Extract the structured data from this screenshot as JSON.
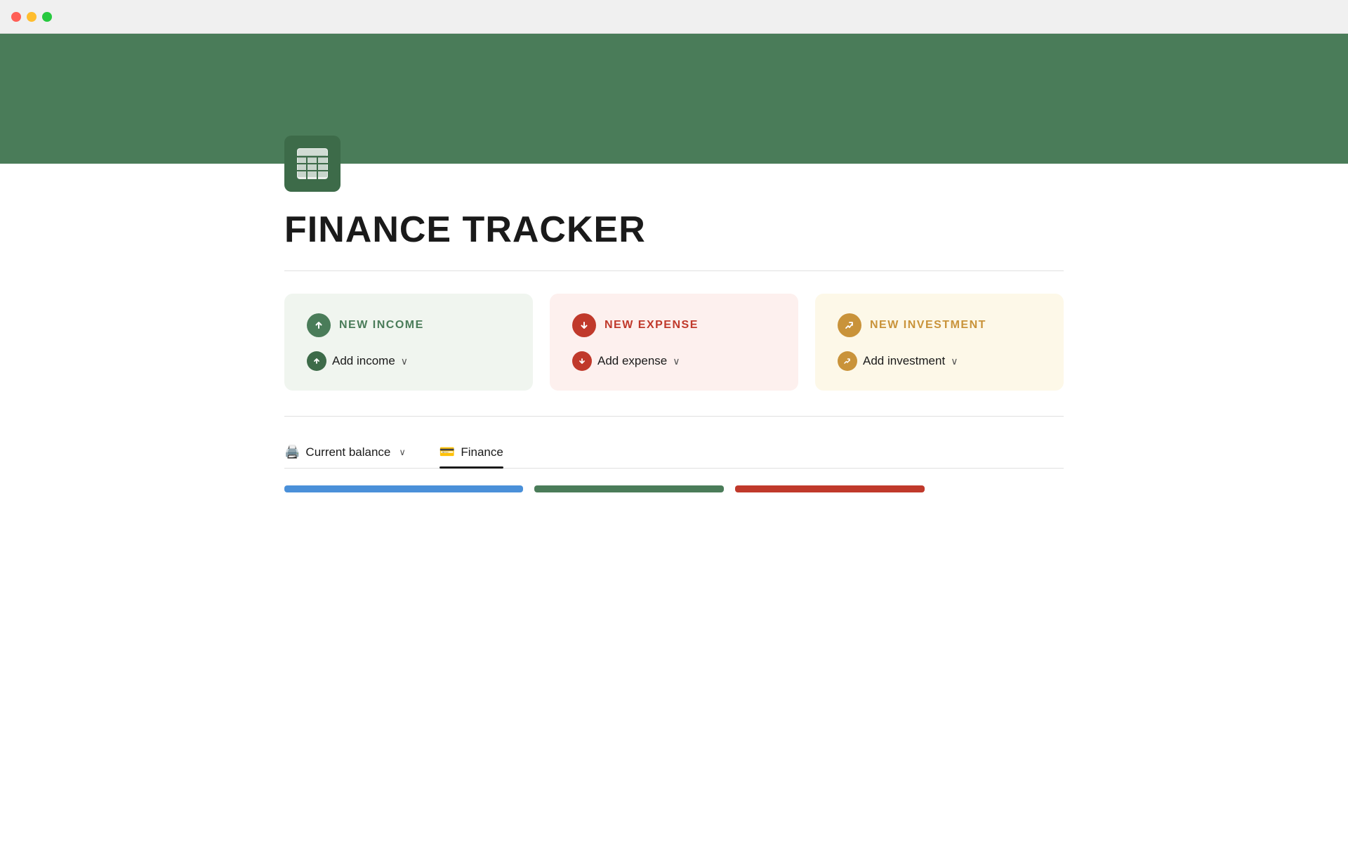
{
  "titlebar": {
    "traffic_lights": [
      "red",
      "yellow",
      "green"
    ]
  },
  "header": {
    "banner_color": "#4a7c59"
  },
  "app": {
    "icon_label": "spreadsheet-icon"
  },
  "page": {
    "title": "FINANCE TRACKER"
  },
  "cards": [
    {
      "id": "income",
      "title": "NEW INCOME",
      "action_label": "Add income",
      "color_class": "income"
    },
    {
      "id": "expense",
      "title": "NEW EXPENSE",
      "action_label": "Add expense",
      "color_class": "expense"
    },
    {
      "id": "investment",
      "title": "NEW INVESTMENT",
      "action_label": "Add investment",
      "color_class": "investment"
    }
  ],
  "tabs": [
    {
      "id": "current-balance",
      "label": "Current balance",
      "icon": "🖨",
      "active": false
    },
    {
      "id": "finance",
      "label": "Finance",
      "icon": "💳",
      "active": true
    }
  ]
}
